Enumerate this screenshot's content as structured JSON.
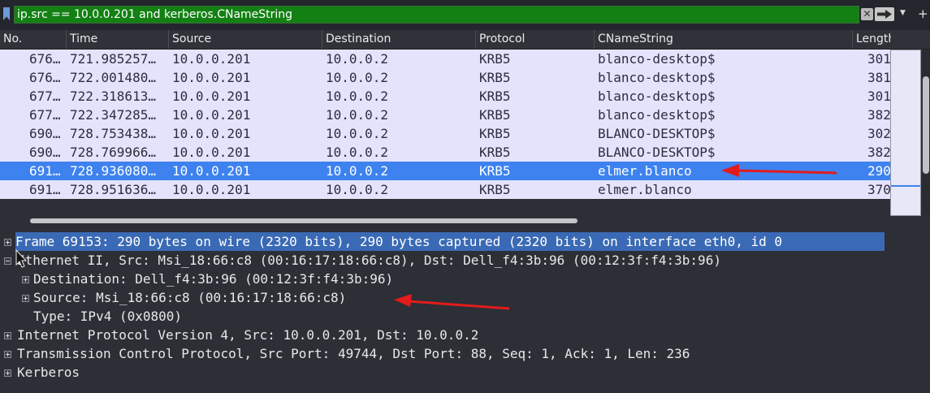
{
  "filter": {
    "value": "ip.src == 10.0.0.201 and kerberos.CNameString",
    "clear_icon": "✕"
  },
  "columns": [
    "No.",
    "Time",
    "Source",
    "Destination",
    "Protocol",
    "CNameString",
    "Length"
  ],
  "packets": [
    {
      "no": "676…",
      "time": "721.985257…",
      "source": "10.0.0.201",
      "destination": "10.0.0.2",
      "protocol": "KRB5",
      "cname": "blanco-desktop$",
      "length": "301"
    },
    {
      "no": "676…",
      "time": "722.001480…",
      "source": "10.0.0.201",
      "destination": "10.0.0.2",
      "protocol": "KRB5",
      "cname": "blanco-desktop$",
      "length": "381"
    },
    {
      "no": "677…",
      "time": "722.318613…",
      "source": "10.0.0.201",
      "destination": "10.0.0.2",
      "protocol": "KRB5",
      "cname": "blanco-desktop$",
      "length": "301"
    },
    {
      "no": "677…",
      "time": "722.347285…",
      "source": "10.0.0.201",
      "destination": "10.0.0.2",
      "protocol": "KRB5",
      "cname": "blanco-desktop$",
      "length": "382"
    },
    {
      "no": "690…",
      "time": "728.753438…",
      "source": "10.0.0.201",
      "destination": "10.0.0.2",
      "protocol": "KRB5",
      "cname": "BLANCO-DESKTOP$",
      "length": "302"
    },
    {
      "no": "690…",
      "time": "728.769966…",
      "source": "10.0.0.201",
      "destination": "10.0.0.2",
      "protocol": "KRB5",
      "cname": "BLANCO-DESKTOP$",
      "length": "382"
    },
    {
      "no": "691…",
      "time": "728.936080…",
      "source": "10.0.0.201",
      "destination": "10.0.0.2",
      "protocol": "KRB5",
      "cname": "elmer.blanco",
      "length": "290"
    },
    {
      "no": "691…",
      "time": "728.951636…",
      "source": "10.0.0.201",
      "destination": "10.0.0.2",
      "protocol": "KRB5",
      "cname": "elmer.blanco",
      "length": "370"
    }
  ],
  "details": {
    "frame": "Frame 69153: 290 bytes on wire (2320 bits), 290 bytes captured (2320 bits) on interface eth0, id 0",
    "ethernet": "Ethernet II, Src: Msi_18:66:c8 (00:16:17:18:66:c8), Dst: Dell_f4:3b:96 (00:12:3f:f4:3b:96)",
    "eth_destination": "Destination: Dell_f4:3b:96 (00:12:3f:f4:3b:96)",
    "eth_source": "Source: Msi_18:66:c8 (00:16:17:18:66:c8)",
    "eth_type": "Type: IPv4 (0x0800)",
    "ip": "Internet Protocol Version 4, Src: 10.0.0.201, Dst: 10.0.0.2",
    "tcp": "Transmission Control Protocol, Src Port: 49744, Dst Port: 88, Seq: 1, Ack: 1, Len: 236",
    "kerberos": "Kerberos"
  },
  "colors": {
    "filter_valid": "#138013",
    "row_background": "#e4e3fb",
    "selected_row": "#3d82ef",
    "annotation_arrow": "#e21b1b"
  }
}
